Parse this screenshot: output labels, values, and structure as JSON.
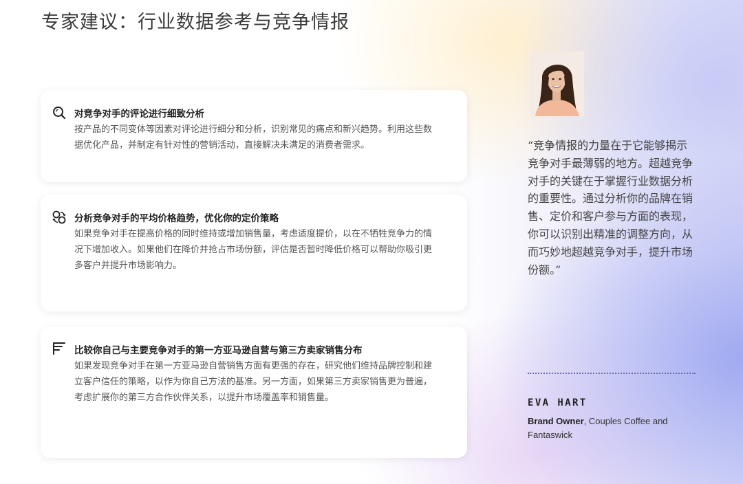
{
  "page": {
    "title": "专家建议：行业数据参考与竞争情报"
  },
  "cards": [
    {
      "icon": "magnifier-icon",
      "title": "对竞争对手的评论进行细致分析",
      "body": "按产品的不同变体等因素对评论进行细分和分析，识别常见的痛点和新兴趋势。利用这些数据优化产品，并制定有针对性的营销活动，直接解决未满足的消费者需求。"
    },
    {
      "icon": "price-trend-icon",
      "title": "分析竞争对手的平均价格趋势，优化你的定价策略",
      "body": "如果竞争对手在提高价格的同时维持或增加销售量，考虑适度提价，以在不牺牲竞争力的情况下增加收入。如果他们在降价并抢占市场份额，评估是否暂时降低价格可以帮助你吸引更多客户并提升市场影响力。"
    },
    {
      "icon": "distribution-icon",
      "title": "比较你自己与主要竞争对手的第一方亚马逊自营与第三方卖家销售分布",
      "body": "如果发现竞争对手在第一方亚马逊自营销售方面有更强的存在，研究他们维持品牌控制和建立客户信任的策略，以作为你自己方法的基准。另一方面，如果第三方卖家销售更为普遍，考虑扩展你的第三方合作伙伴关系，以提升市场覆盖率和销售量。"
    }
  ],
  "testimonial": {
    "quote": "“竞争情报的力量在于它能够揭示竞争对手最薄弱的地方。超越竞争对手的关键在于掌握行业数据分析的重要性。通过分析你的品牌在销售、定价和客户参与方面的表现，你可以识别出精准的调整方向，从而巧妙地超越竞争对手，提升市场份额。”",
    "name": "EVA HART",
    "role": "Brand Owner",
    "company": ", Couples Coffee and Fantaswick"
  },
  "colors": {
    "accent": "#6b6ba8",
    "skin": "#e9c2a6",
    "hair": "#3a2418",
    "jacket": "#f2b89a"
  }
}
